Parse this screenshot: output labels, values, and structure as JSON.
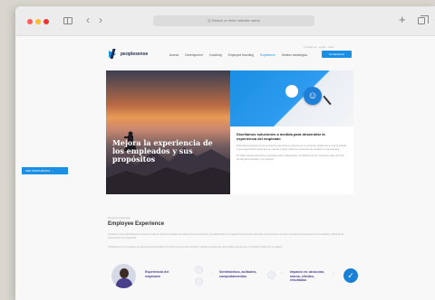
{
  "browser": {
    "url_placeholder": "Q  Search or enter website name",
    "back_glyph": "‹",
    "forward_glyph": "›",
    "new_tab_glyph": "+",
    "traffic_light_colors": [
      "#ff5f57",
      "#febc2e",
      "#e33333"
    ]
  },
  "site": {
    "utility_links": "Contact us  ·  Login  ·  Jobs",
    "logo_text": "peoplesense",
    "nav": [
      {
        "label": "Acerca"
      },
      {
        "label": "Development"
      },
      {
        "label": "Coaching"
      },
      {
        "label": "Employee branding"
      },
      {
        "label": "Experience",
        "active": true
      },
      {
        "label": "Gestión estratégica"
      }
    ],
    "contact_button": "Contáctanos",
    "hero": {
      "title": "Mejora la experiencia de los empleados y sus propósitos",
      "button": "VER PROPUESTAS  →"
    },
    "card": {
      "title": "Diseñamos soluciones a medida para desarrollar la experiencia del empleado",
      "para1": "El Employee Experience es la vivencia que tiene un persona en su empresa, desde que se siente atraída a una organización hasta que se marcha. Incluye todos los momentos de contacto con la empresa.",
      "para2": "En Talent Sense ofrecemos programas para el diagnóstico, el rediseño de los momentos clave del ciclo de vida del empleado y su medición."
    },
    "section": {
      "kicker": "Nuestra propuesta",
      "title": "Employee Experience",
      "text1": "Ayudamos a las organizaciones a crear un ciclo de vida del empleado que favorezca el compromiso, la productividad y el orgullo de pertenencia, poniendo a la persona en el centro de todas las decisiones de la compañía y alineando la experiencia con el propósito.",
      "text2": "Trabajamos con los equipos de personas para identificar los momentos que más importan y diseñar experiencias memorables que generen un impacto positivo en el negocio."
    },
    "flow": {
      "step1": "Experiencia del empleado",
      "step2": "Sentimientos, actitudes, comportamientos",
      "step3": "Impacto en: atracción, marca, clientes, resultados",
      "chevron_glyph": "›",
      "check_glyph": "✓"
    },
    "accent_color": "#1a8fe3"
  }
}
